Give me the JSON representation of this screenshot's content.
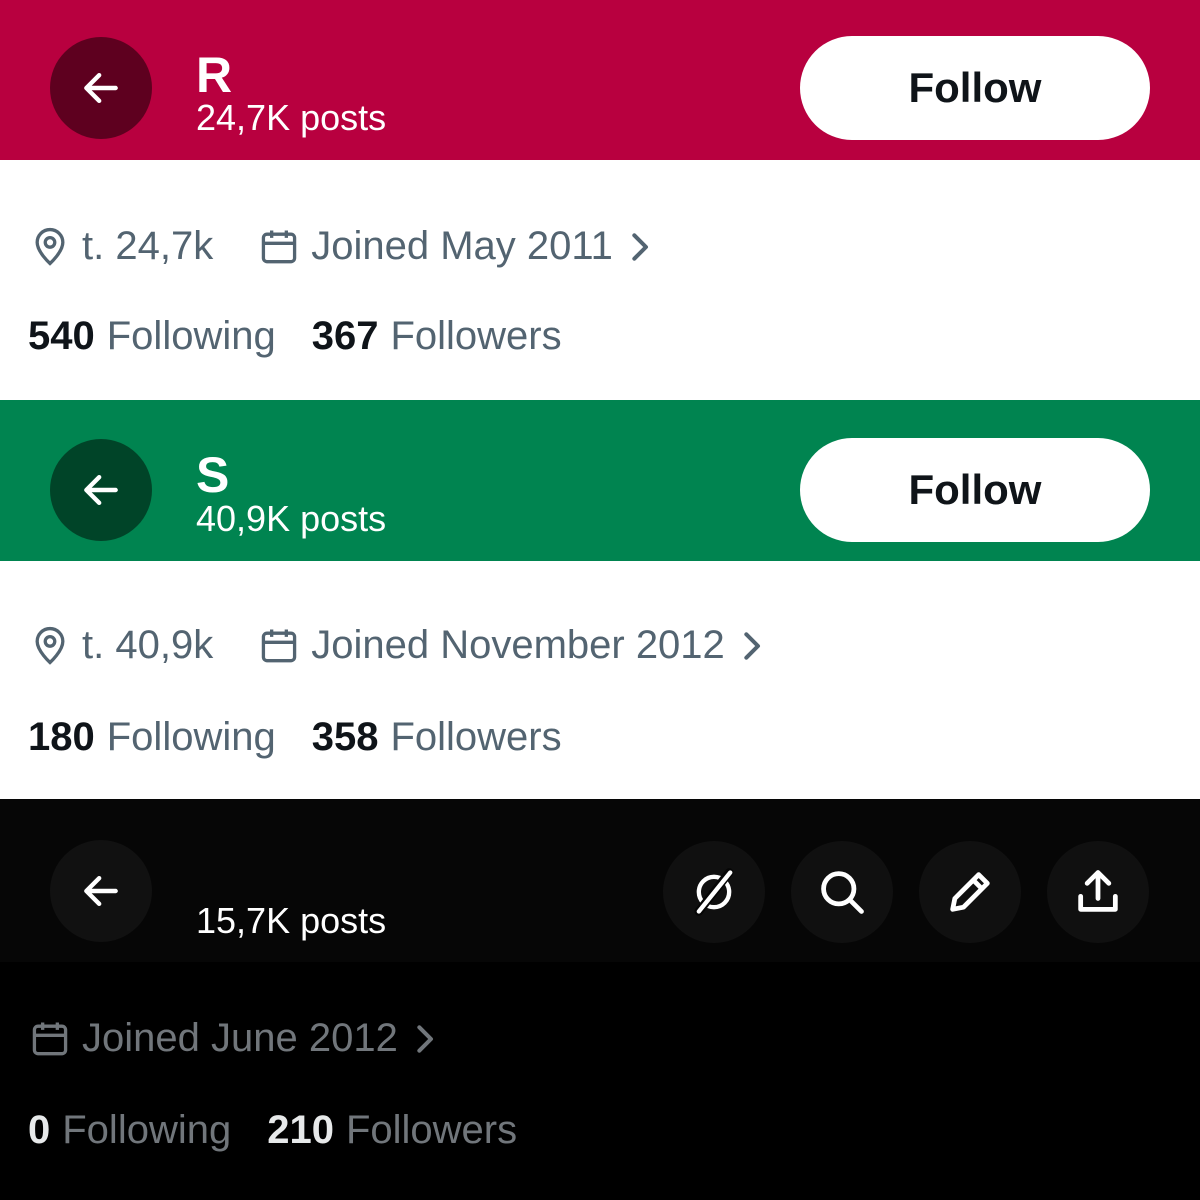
{
  "profiles": [
    {
      "header": {
        "title": "R",
        "posts": "24,7K posts",
        "follow_label": "Follow",
        "bg": "#B8003F",
        "back_bg": "#5E001F"
      },
      "location": "t. 24,7k",
      "joined": "Joined May 2011",
      "following_count": "540",
      "following_label": "Following",
      "followers_count": "367",
      "followers_label": "Followers"
    },
    {
      "header": {
        "title": "S",
        "posts": "40,9K posts",
        "follow_label": "Follow",
        "bg": "#008450",
        "back_bg": "#004428"
      },
      "location": "t. 40,9k",
      "joined": "Joined November 2012",
      "following_count": "180",
      "following_label": "Following",
      "followers_count": "358",
      "followers_label": "Followers"
    },
    {
      "header": {
        "title": "",
        "posts": "15,7K posts",
        "bg": "#060606",
        "back_bg": "#111111"
      },
      "joined": "Joined June 2012",
      "following_count": "0",
      "following_label": "Following",
      "followers_count": "210",
      "followers_label": "Followers",
      "toolbar_icons": [
        "grok-icon",
        "search-icon",
        "edit-icon",
        "share-icon"
      ]
    }
  ],
  "colors": {
    "secondary_text": "#536471",
    "primary_text": "#0F1419",
    "dark_secondary_text": "#71767B"
  }
}
